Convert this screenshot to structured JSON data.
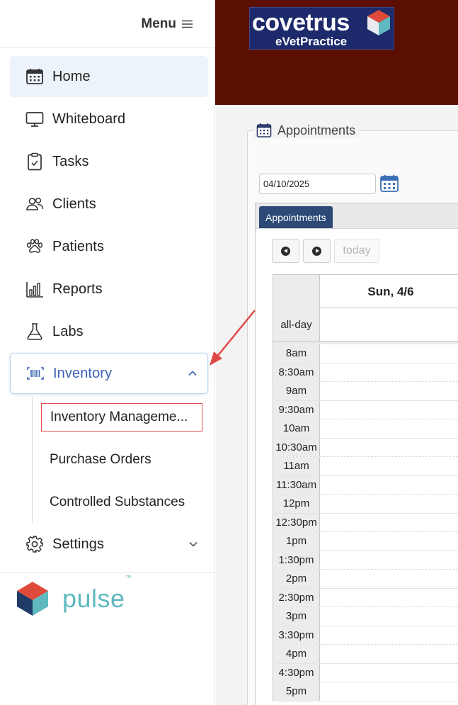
{
  "sidebar": {
    "menu_label": "Menu",
    "items": [
      {
        "label": "Home",
        "icon": "calendar-icon",
        "active": true
      },
      {
        "label": "Whiteboard",
        "icon": "monitor-icon"
      },
      {
        "label": "Tasks",
        "icon": "clipboard-icon"
      },
      {
        "label": "Clients",
        "icon": "people-icon"
      },
      {
        "label": "Patients",
        "icon": "paw-icon"
      },
      {
        "label": "Reports",
        "icon": "bar-chart-icon"
      },
      {
        "label": "Labs",
        "icon": "flask-icon"
      },
      {
        "label": "Inventory",
        "icon": "barcode-icon",
        "expanded": true
      },
      {
        "label": "Settings",
        "icon": "gear-icon"
      }
    ],
    "inventory_subitems": [
      "Inventory Manageme...",
      "Purchase Orders",
      "Controlled Substances"
    ],
    "footer_logo": "pulse",
    "footer_logo_tm": "™"
  },
  "header": {
    "brand_name": "covetrus",
    "brand_sub": "eVetPractice",
    "background": "#5b0f00"
  },
  "appointments_panel": {
    "title": "Appointments",
    "date_value": "04/10/2025",
    "tab_label": "Appointments",
    "today_label": "today",
    "day_header": "Sun, 4/6",
    "allday_label": "all-day",
    "times": [
      "8am",
      "8:30am",
      "9am",
      "9:30am",
      "10am",
      "10:30am",
      "11am",
      "11:30am",
      "12pm",
      "12:30pm",
      "1pm",
      "1:30pm",
      "2pm",
      "2:30pm",
      "3pm",
      "3:30pm",
      "4pm",
      "4:30pm",
      "5pm"
    ]
  },
  "colors": {
    "accent": "#3d63b3",
    "tab": "#2d4a77",
    "pulse": "#5fb9bf",
    "annotation": "#e04848"
  }
}
